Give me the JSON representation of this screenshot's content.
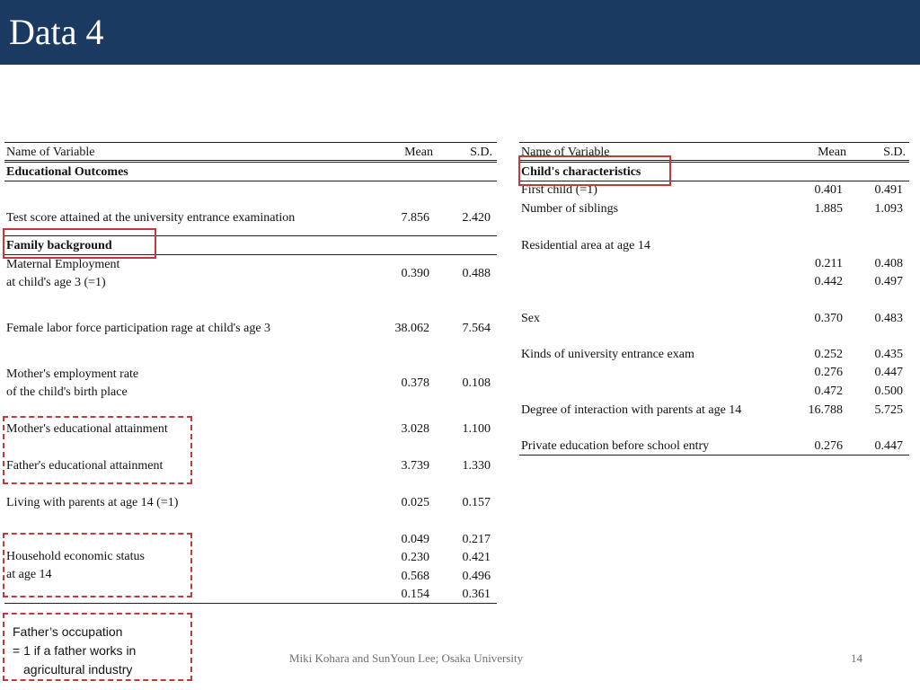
{
  "title": "Data 4",
  "left_table": {
    "header": {
      "name": "Name of Variable",
      "mean": "Mean",
      "sd": "S.D."
    },
    "section1": "Educational Outcomes",
    "test": {
      "label": "Test score attained at the university entrance examination",
      "mean": "7.856",
      "sd": "2.420"
    },
    "section2": "Family background",
    "maternal": {
      "line1": "Maternal Employment",
      "line2": " at child's age 3 (=1)",
      "mean": "0.390",
      "sd": "0.488"
    },
    "female": {
      "label": "Female labor force participation rage at child's age 3",
      "mean": "38.062",
      "sd": "7.564"
    },
    "mother_rate": {
      "line1": "Mother's employment rate",
      "line2": "of the child's birth place",
      "mean": "0.378",
      "sd": "0.108"
    },
    "mother_edu": {
      "label": "Mother's educational attainment",
      "mean": "3.028",
      "sd": "1.100"
    },
    "father_edu": {
      "label": "Father's educational attainment",
      "mean": "3.739",
      "sd": "1.330"
    },
    "living": {
      "label": "Living with parents at age 14 (=1)",
      "mean": "0.025",
      "sd": "0.157"
    },
    "household": {
      "line1": "Household economic status",
      "line2": "at age 14",
      "means": [
        "0.049",
        "0.230",
        "0.568",
        "0.154"
      ],
      "sds": [
        "0.217",
        "0.421",
        "0.496",
        "0.361"
      ]
    }
  },
  "right_table": {
    "header": {
      "name": "Name of Variable",
      "mean": "Mean",
      "sd": "S.D."
    },
    "section": "Child's characteristics",
    "first_child": {
      "label": "First child (=1)",
      "mean": "0.401",
      "sd": "0.491"
    },
    "siblings": {
      "label": "Number of siblings",
      "mean": "1.885",
      "sd": "1.093"
    },
    "residential": {
      "label": "Residential area at age 14",
      "means": [
        "0.211",
        "0.442"
      ],
      "sds": [
        "0.408",
        "0.497"
      ]
    },
    "sex": {
      "label": "Sex",
      "mean": "0.370",
      "sd": "0.483"
    },
    "kinds": {
      "label": "Kinds of university entrance exam",
      "means": [
        "0.252",
        "0.276",
        "0.472"
      ],
      "sds": [
        "0.435",
        "0.447",
        "0.500"
      ]
    },
    "interaction": {
      "label": "Degree of interaction with parents at age 14",
      "mean": "16.788",
      "sd": "5.725"
    },
    "private": {
      "label": "Private education before school entry",
      "mean": "0.276",
      "sd": "0.447"
    }
  },
  "note": {
    "line1": "Father’s occupation",
    "line2": "= 1 if a father works in",
    "line3": "agricultural industry"
  },
  "footer": {
    "authors": "Miki Kohara and SunYoun Lee;  Osaka University",
    "page": "14"
  },
  "colors": {
    "header_bg": "#1b3a62",
    "highlight": "#c23b3b"
  }
}
